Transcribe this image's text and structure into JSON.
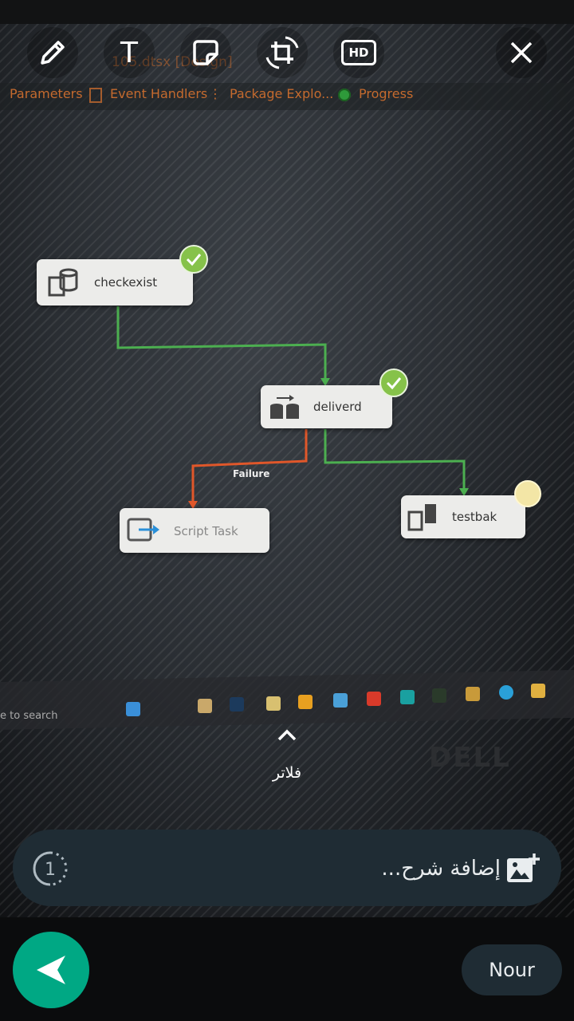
{
  "toolbar": {
    "draw": "pencil-icon",
    "text": "T",
    "sticker": "sticker-icon",
    "crop": "crop-rotate-icon",
    "hd": "HD",
    "close": "close-icon"
  },
  "photo": {
    "file_tab": "105.dtsx [Design]",
    "menu": [
      "Parameters",
      "Event Handlers",
      "Package Explo...",
      "Progress"
    ],
    "nodes": {
      "checkexist": "checkexist",
      "deliverd": "deliverd",
      "script_task": "Script Task",
      "testbak": "testbak"
    },
    "failure_label": "Failure",
    "taskbar_search": "e to search",
    "monitor_brand": "DELL"
  },
  "filters": {
    "label": "فلاتر"
  },
  "caption": {
    "placeholder": "إضافة شرح..."
  },
  "recipient": {
    "name": "Nour"
  },
  "colors": {
    "accent": "#00a884",
    "caption_bg": "#1f2c34",
    "success_line": "#4caf50",
    "failure_line": "#e0572a"
  }
}
